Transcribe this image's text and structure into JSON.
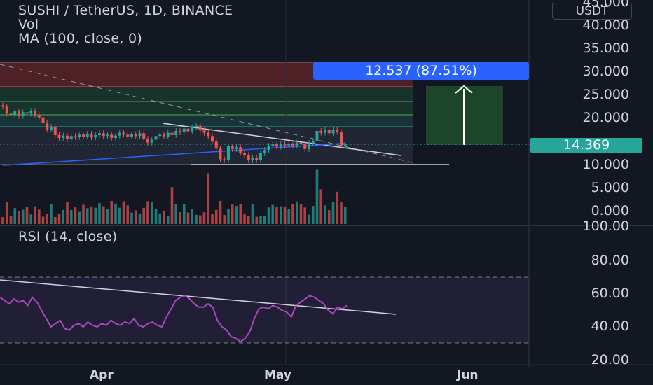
{
  "header": {
    "title": "SUSHI / TetherUS, 1D, BINANCE",
    "vol_label": "Vol",
    "ma_label": "MA (100, close, 0)",
    "currency_badge": "USDT"
  },
  "measure_tool": {
    "label": "12.537 (87.51%)"
  },
  "last_price": {
    "label": "14.369"
  },
  "price_axis": {
    "ticks": [
      "45.000",
      "40.000",
      "35.000",
      "30.000",
      "25.000",
      "20.000",
      "10.000",
      "5.000",
      "0.000",
      "100.00"
    ]
  },
  "rsi": {
    "label": "RSI (14, close)",
    "ticks": [
      "80.00",
      "60.00",
      "40.00",
      "20.00"
    ]
  },
  "time_axis": {
    "ticks": [
      "Apr",
      "May",
      "Jun"
    ]
  },
  "colors": {
    "background": "#131722",
    "up": "#26a69a",
    "down": "#ef5350",
    "ma": "#2962ff",
    "rsi": "#9c27b0",
    "accent": "#2962ff"
  },
  "chart_data": {
    "type": "candlestick",
    "symbol": "SUSHI / TetherUS",
    "interval": "1D",
    "exchange": "BINANCE",
    "price_ylim": [
      0,
      45
    ],
    "candles_close": [
      22.5,
      21.0,
      20.8,
      21.5,
      20.5,
      21.3,
      21.0,
      21.6,
      20.8,
      20.2,
      19.0,
      17.6,
      18.2,
      16.4,
      15.8,
      16.3,
      15.5,
      16.2,
      16.0,
      16.5,
      16.1,
      16.7,
      15.9,
      16.4,
      16.8,
      16.2,
      16.5,
      15.8,
      16.3,
      16.9,
      16.5,
      16.1,
      16.6,
      16.2,
      16.8,
      15.6,
      14.8,
      15.4,
      16.2,
      16.5,
      16.1,
      16.9,
      16.4,
      17.3,
      17.0,
      17.8,
      17.2,
      18.1,
      18.4,
      17.4,
      16.9,
      16.2,
      15.0,
      13.5,
      11.2,
      11.0,
      14.0,
      13.4,
      13.8,
      12.6,
      12.1,
      11.0,
      11.5,
      11.0,
      12.5,
      13.2,
      14.1,
      14.4,
      13.9,
      14.5,
      14.2,
      14.6,
      14.1,
      14.8,
      14.5,
      13.4,
      14.7,
      15.2,
      17.3,
      16.9,
      17.5,
      16.8,
      17.6,
      17.1,
      14.1,
      14.4
    ],
    "volume_ylim": [
      0,
      5
    ],
    "rsi_values": [
      58,
      56,
      54,
      57,
      55,
      56,
      53,
      58,
      55,
      50,
      45,
      40,
      42,
      44,
      39,
      38,
      41,
      42,
      40,
      43,
      41,
      40,
      42,
      41,
      44,
      42,
      41,
      43,
      42,
      45,
      41,
      40,
      42,
      43,
      41,
      40,
      46,
      51,
      56,
      58,
      59,
      57,
      54,
      52,
      52,
      54,
      52,
      44,
      40,
      38,
      34,
      33,
      31,
      33,
      37,
      45,
      51,
      52,
      51,
      53,
      52,
      50,
      49,
      46,
      53,
      55,
      57,
      59,
      58,
      56,
      54,
      50,
      48,
      52,
      51,
      53
    ],
    "rsi_ylim": [
      20,
      100
    ],
    "rsi_bands": [
      70,
      30
    ],
    "ma_period": 100
  }
}
